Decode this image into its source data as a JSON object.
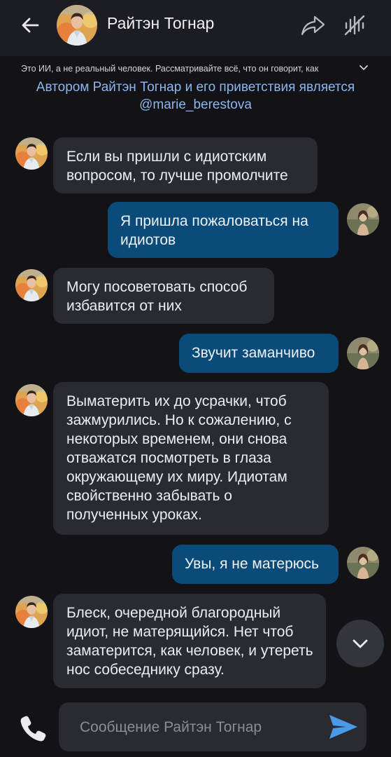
{
  "header": {
    "title": "Райтэн Тогнар",
    "back_icon": "arrow-left-icon",
    "share_icon": "share-icon",
    "mute_icon": "mute-icon",
    "bot_avatar_icon": "character-avatar",
    "user_avatar_icon": "user-avatar"
  },
  "disclaimer": {
    "text": "Это ИИ, а не реальный человек. Рассматривайте всё, что он говорит, как",
    "expand_icon": "chevron-down-icon"
  },
  "creator": {
    "line1": "Автором Райтэн Тогнар и его приветствия является",
    "line2": "@marie_berestova"
  },
  "messages": [
    {
      "from": "bot",
      "text": "Если вы пришли с идиотским вопросом, то лучше промолчите"
    },
    {
      "from": "user",
      "text": "Я пришла пожаловаться на идиотов"
    },
    {
      "from": "bot",
      "text": "Могу посоветовать способ избавится от них"
    },
    {
      "from": "user",
      "text": "Звучит заманчиво"
    },
    {
      "from": "bot",
      "text": "Выматерить их до усрачки, чтоб зажмурились. Но к сожалению, с некоторых временем, они снова отважатся посмотреть в глаза окружающему их миру. Идиотам свойственно забывать о полученных уроках."
    },
    {
      "from": "user",
      "text": "Увы, я не матерюсь"
    },
    {
      "from": "bot",
      "text": "Блеск, очередной благородный идиот, не матерящийся. Нет чтоб заматерится, как человек, и утереть нос собеседнику сразу."
    }
  ],
  "composer": {
    "placeholder": "Сообщение Райтэн Тогнар",
    "value": "",
    "call_icon": "phone-icon",
    "send_icon": "send-icon",
    "scroll_icon": "chevron-down-icon"
  },
  "colors": {
    "background": "#121217",
    "header": "#1c1d22",
    "bot_bubble": "#2a2b31",
    "user_bubble": "#0a4b79",
    "creator_link": "#8db6ea"
  }
}
